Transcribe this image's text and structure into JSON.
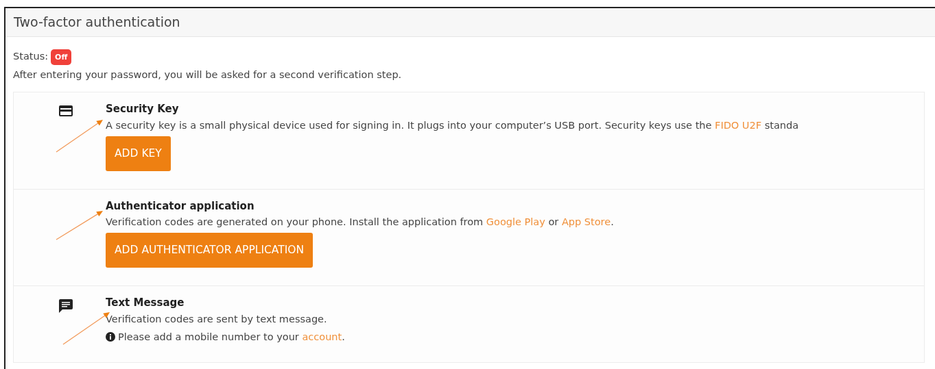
{
  "header": {
    "title": "Two-factor authentication"
  },
  "status": {
    "label": "Status:",
    "badge": "Off",
    "on": false
  },
  "intro": "After entering your password, you will be asked for a second verification step.",
  "methods": [
    {
      "kind": "security_key",
      "title": "Security Key",
      "description": [
        {
          "kind": "text",
          "text": "A security key is a small physical device used for signing in. It plugs into your computer’s USB port. Security keys use the "
        },
        {
          "kind": "link",
          "text": "FIDO U2F"
        },
        {
          "kind": "text",
          "text": " standa"
        }
      ],
      "button": "ADD KEY"
    },
    {
      "kind": "authenticator",
      "title": "Authenticator application",
      "description": [
        {
          "kind": "text",
          "text": "Verification codes are generated on your phone. Install the application from "
        },
        {
          "kind": "link",
          "text": "Google Play"
        },
        {
          "kind": "text",
          "text": " or "
        },
        {
          "kind": "link",
          "text": "App Store"
        },
        {
          "kind": "text",
          "text": "."
        }
      ],
      "button": "ADD AUTHENTICATOR APPLICATION"
    },
    {
      "kind": "sms",
      "title": "Text Message",
      "description": [
        {
          "kind": "text",
          "text": "Verification codes are sent by text message."
        }
      ],
      "note": [
        {
          "kind": "text",
          "text": "Please add a mobile number to your "
        },
        {
          "kind": "link",
          "text": "account"
        },
        {
          "kind": "text",
          "text": "."
        }
      ]
    }
  ]
}
